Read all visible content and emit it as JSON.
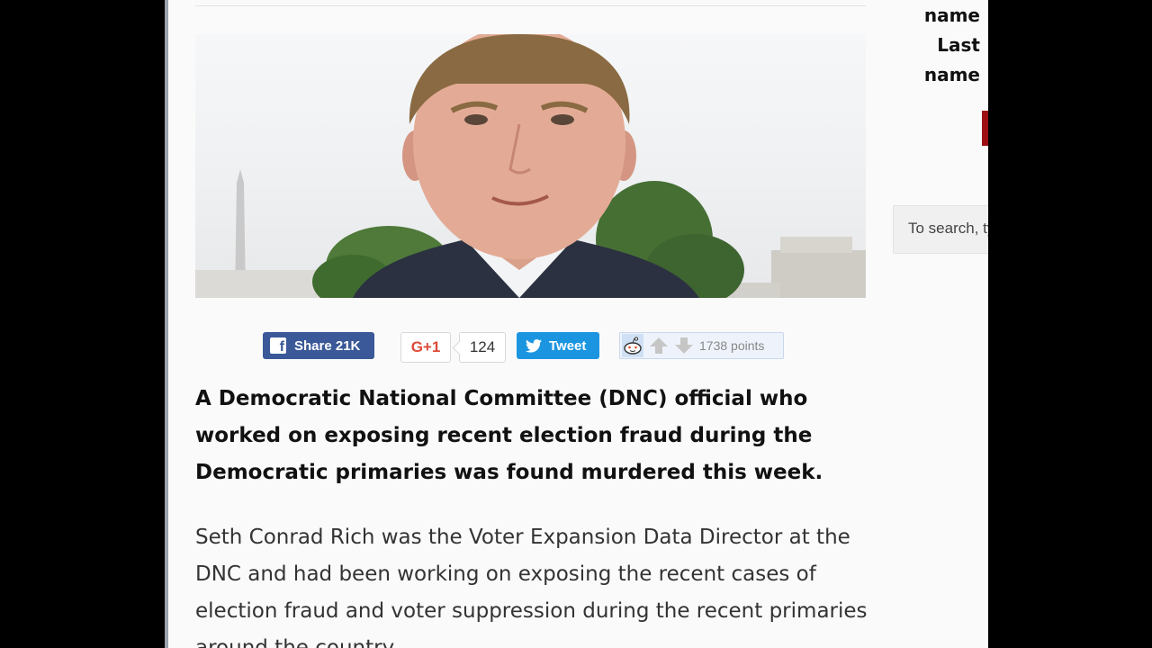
{
  "article": {
    "lead": "A Democratic National Committee (DNC) official who worked on exposing recent election fraud during the Democratic primaries was found murdered this week.",
    "body": "Seth Conrad Rich was the Voter Expansion Data Director at the DNC and had been working on exposing the recent cases of election fraud and voter suppression during the recent primaries around the country."
  },
  "share": {
    "facebook_label": "Share 21K",
    "google_label": "G+1",
    "google_count": "124",
    "twitter_label": "Tweet",
    "reddit_points": "1738 points"
  },
  "sidebar": {
    "first_name_label": "name",
    "last_name_label": "Last",
    "last_name_label_2": "name",
    "search_placeholder": "To search, type and hit enter"
  },
  "colors": {
    "facebook": "#3b5998",
    "twitter": "#1b95e0",
    "google": "#dd4b39",
    "accent_red": "#9b0f12"
  },
  "icons": [
    "facebook-icon",
    "twitter-bird-icon",
    "reddit-alien-icon",
    "upvote-arrow-icon",
    "downvote-arrow-icon"
  ]
}
